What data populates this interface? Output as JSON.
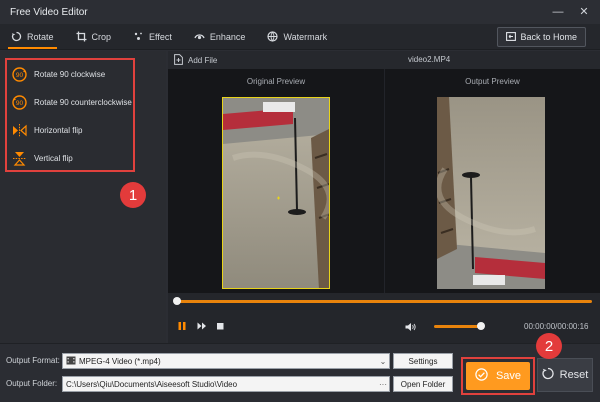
{
  "window": {
    "title": "Free Video Editor"
  },
  "tabs": [
    {
      "label": "Rotate",
      "icon": "rotate-icon",
      "active": true
    },
    {
      "label": "Crop",
      "icon": "crop-icon",
      "active": false
    },
    {
      "label": "Effect",
      "icon": "effect-icon",
      "active": false
    },
    {
      "label": "Enhance",
      "icon": "enhance-icon",
      "active": false
    },
    {
      "label": "Watermark",
      "icon": "watermark-icon",
      "active": false
    }
  ],
  "back_button": {
    "label": "Back to Home",
    "icon": "home-icon"
  },
  "rotate_options": [
    {
      "label": "Rotate 90 clockwise",
      "icon": "rotate-cw-icon",
      "glyph": "90"
    },
    {
      "label": "Rotate 90 counterclockwise",
      "icon": "rotate-ccw-icon",
      "glyph": "90"
    },
    {
      "label": "Horizontal flip",
      "icon": "flip-horizontal-icon"
    },
    {
      "label": "Vertical flip",
      "icon": "flip-vertical-icon"
    }
  ],
  "callouts": {
    "first": "1",
    "second": "2"
  },
  "preview": {
    "add_file_label": "Add File",
    "file_name": "video2.MP4",
    "original_label": "Original Preview",
    "output_label": "Output Preview"
  },
  "playback": {
    "progress": 1.0,
    "volume": 0.6,
    "timecode": "00:00:00/00:00:16"
  },
  "output": {
    "format_label": "Output Format:",
    "format_value": "MPEG-4 Video (*.mp4)",
    "settings_label": "Settings",
    "folder_label": "Output Folder:",
    "folder_value": "C:\\Users\\Qiu\\Documents\\Aiseesoft Studio\\Video",
    "folder_browse": "···",
    "open_folder_label": "Open Folder"
  },
  "actions": {
    "save_label": "Save",
    "reset_label": "Reset"
  },
  "colors": {
    "accent": "#ff8a00",
    "save": "#ff9a1f",
    "callout": "#e33b3b",
    "highlight_border": "#e0413d"
  }
}
